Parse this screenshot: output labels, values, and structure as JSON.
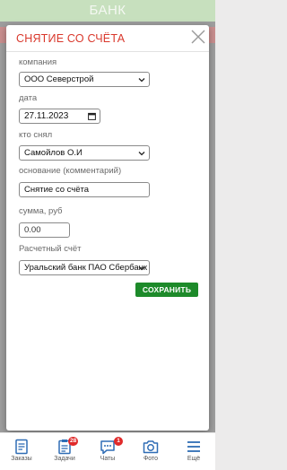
{
  "app": {
    "title": "БАНК"
  },
  "modal": {
    "title": "СНЯТИЕ СО СЧЁТА",
    "fields": {
      "company": {
        "label": "компания",
        "value": "ООО Северстрой"
      },
      "date": {
        "label": "дата",
        "value": "27.11.2023"
      },
      "withdrawn_by": {
        "label": "кто снял",
        "value": "Самойлов О.И"
      },
      "basis": {
        "label": "основание (комментарий)",
        "value": "Снятие со счёта"
      },
      "amount": {
        "label": "сумма, руб",
        "value": "0.00"
      },
      "account": {
        "label": "Расчетный счёт",
        "value": "Уральский банк ПАО Сбербанк"
      }
    },
    "save_label": "СОХРАНИТЬ"
  },
  "nav": {
    "items": [
      {
        "label": "Заказы",
        "icon": "orders-icon"
      },
      {
        "label": "Задачи",
        "icon": "tasks-icon",
        "badge": "28"
      },
      {
        "label": "Чаты",
        "icon": "chat-icon",
        "badge": "1"
      },
      {
        "label": "Фото",
        "icon": "camera-icon"
      },
      {
        "label": "Ещё",
        "icon": "menu-icon"
      }
    ]
  },
  "colors": {
    "accent_red": "#d9382c",
    "save_green": "#1d8a2a",
    "nav_blue": "#2f6db5",
    "header_green": "#c7e0be"
  }
}
